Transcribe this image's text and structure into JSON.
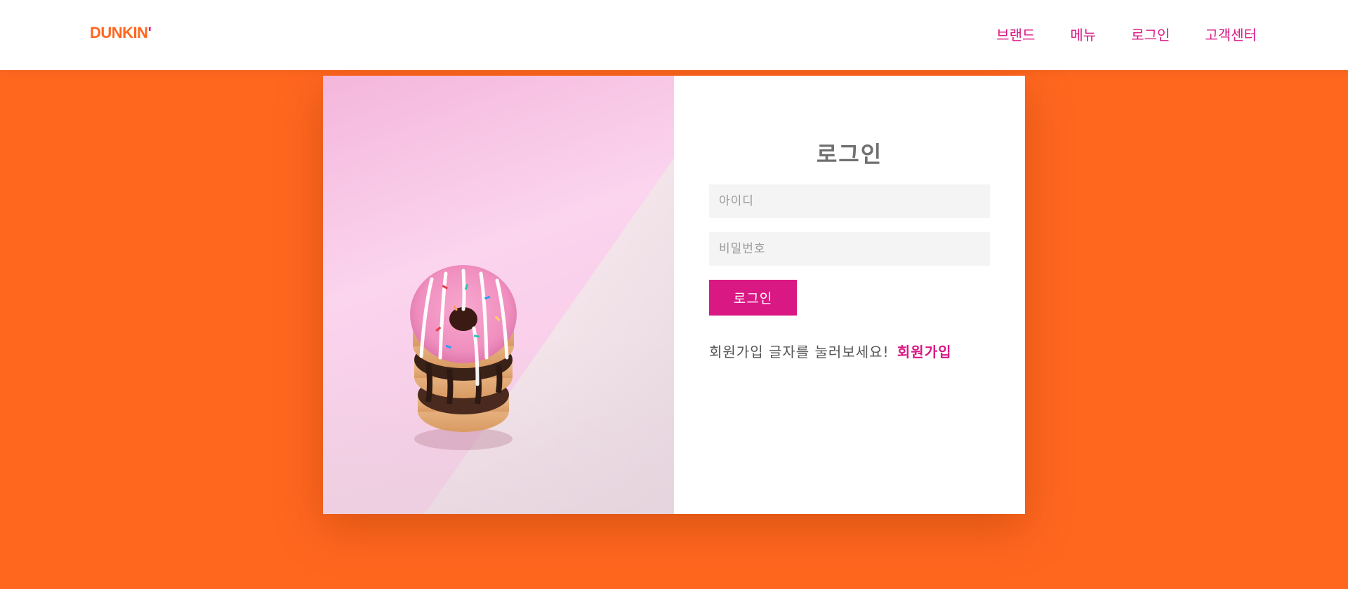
{
  "header": {
    "logo_text": "DUNKIN",
    "logo_apostrophe": "'",
    "nav": [
      {
        "label": "브랜드"
      },
      {
        "label": "메뉴"
      },
      {
        "label": "로그인"
      },
      {
        "label": "고객센터"
      }
    ]
  },
  "login": {
    "title": "로그인",
    "id_placeholder": "아이디",
    "password_placeholder": "비밀번호",
    "submit_label": "로그인",
    "signup_prompt": "회원가입 글자를 눌러보세요!",
    "signup_link": "회원가입"
  },
  "colors": {
    "brand_orange": "#ff671f",
    "brand_pink": "#da1884",
    "field_bg": "#f4f4f4"
  }
}
